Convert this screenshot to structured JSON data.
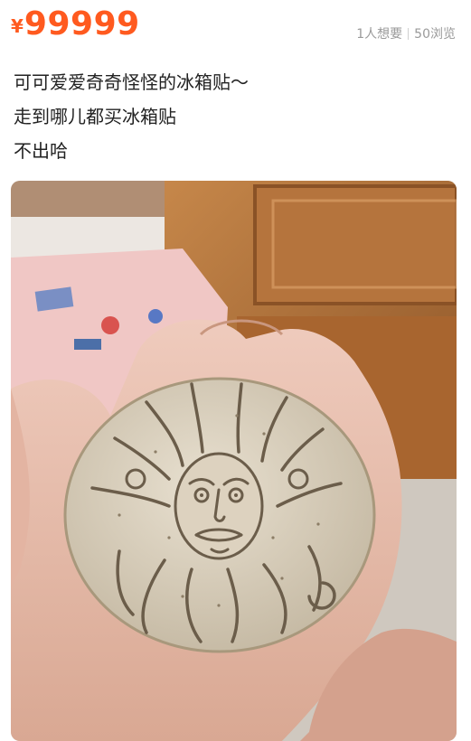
{
  "listing": {
    "currency_symbol": "¥",
    "price": "99999",
    "wants": "1人想要",
    "views": "50浏览",
    "description_lines": [
      "可可爱爱奇奇怪怪的冰箱贴～",
      "走到哪儿都买冰箱贴",
      "不出哈"
    ]
  },
  "colors": {
    "price": "#ff5a1f",
    "stats_text": "#9a9a9a",
    "body_text": "#222222"
  },
  "photo": {
    "subject": "hand-holding-round-clay-fridge-magnet-with-bearded-sun-face"
  }
}
